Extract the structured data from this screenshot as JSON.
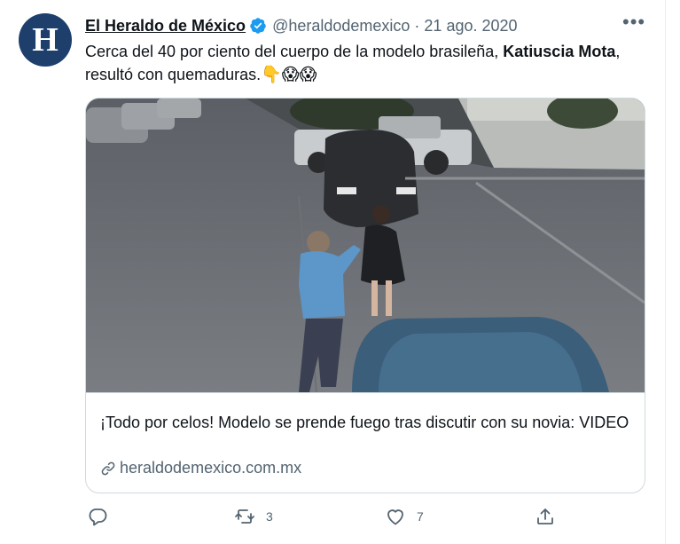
{
  "tweet": {
    "avatar_letter": "H",
    "display_name": "El Heraldo de México",
    "handle": "@heraldodemexico",
    "separator": "·",
    "date": "21 ago. 2020",
    "more_label": "•••",
    "text_before": "Cerca del 40 por ciento del cuerpo de la modelo brasileña, ",
    "text_bold": "Katiuscia Mota",
    "text_after": ", resultó con quemaduras.",
    "emojis": "👇😱😱"
  },
  "card": {
    "title": "¡Todo por celos! Modelo se prende fuego tras discutir con su novia: VIDEO",
    "domain": "heraldodemexico.com.mx"
  },
  "actions": {
    "reply_count": "",
    "retweet_count": "3",
    "like_count": "7"
  },
  "colors": {
    "verified": "#1d9bf0",
    "avatar_bg": "#1e3f6c",
    "secondary_text": "#536471",
    "border": "#cfd9de"
  },
  "icons": [
    "verified-badge-icon",
    "more-icon",
    "link-icon",
    "reply-icon",
    "retweet-icon",
    "like-icon",
    "share-icon"
  ]
}
